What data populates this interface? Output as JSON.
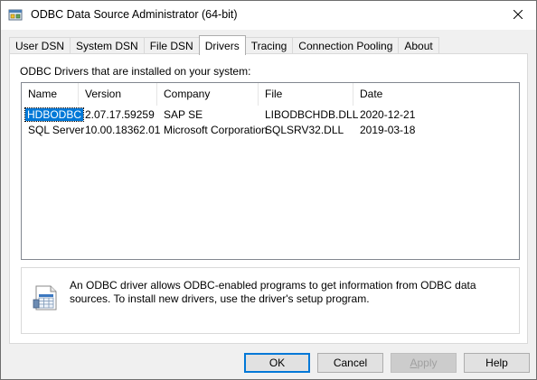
{
  "window": {
    "title": "ODBC Data Source Administrator (64-bit)"
  },
  "tabs": [
    {
      "label": "User DSN",
      "active": false
    },
    {
      "label": "System DSN",
      "active": false
    },
    {
      "label": "File DSN",
      "active": false
    },
    {
      "label": "Drivers",
      "active": true
    },
    {
      "label": "Tracing",
      "active": false
    },
    {
      "label": "Connection Pooling",
      "active": false
    },
    {
      "label": "About",
      "active": false
    }
  ],
  "drivers": {
    "label": "ODBC Drivers that are installed on your system:",
    "columns": [
      "Name",
      "Version",
      "Company",
      "File",
      "Date"
    ],
    "rows": [
      {
        "name": "HDBODBC",
        "version": "2.07.17.59259",
        "company": "SAP SE",
        "file": "LIBODBCHDB.DLL",
        "date": "2020-12-21",
        "selected": true
      },
      {
        "name": "SQL Server",
        "version": "10.00.18362.01",
        "company": "Microsoft Corporation",
        "file": "SQLSRV32.DLL",
        "date": "2019-03-18",
        "selected": false
      }
    ]
  },
  "info": {
    "text": "An ODBC driver allows ODBC-enabled programs to get information from ODBC data sources.  To install new drivers, use the driver's setup program."
  },
  "buttons": {
    "ok": "OK",
    "cancel": "Cancel",
    "apply_first": "A",
    "apply_rest": "pply",
    "help": "Help"
  },
  "icons": {
    "app": "odbc-admin-icon",
    "close": "close-icon",
    "info": "document-table-icon"
  },
  "colors": {
    "selection": "#0078d7",
    "default_button_border": "#0078d7"
  }
}
